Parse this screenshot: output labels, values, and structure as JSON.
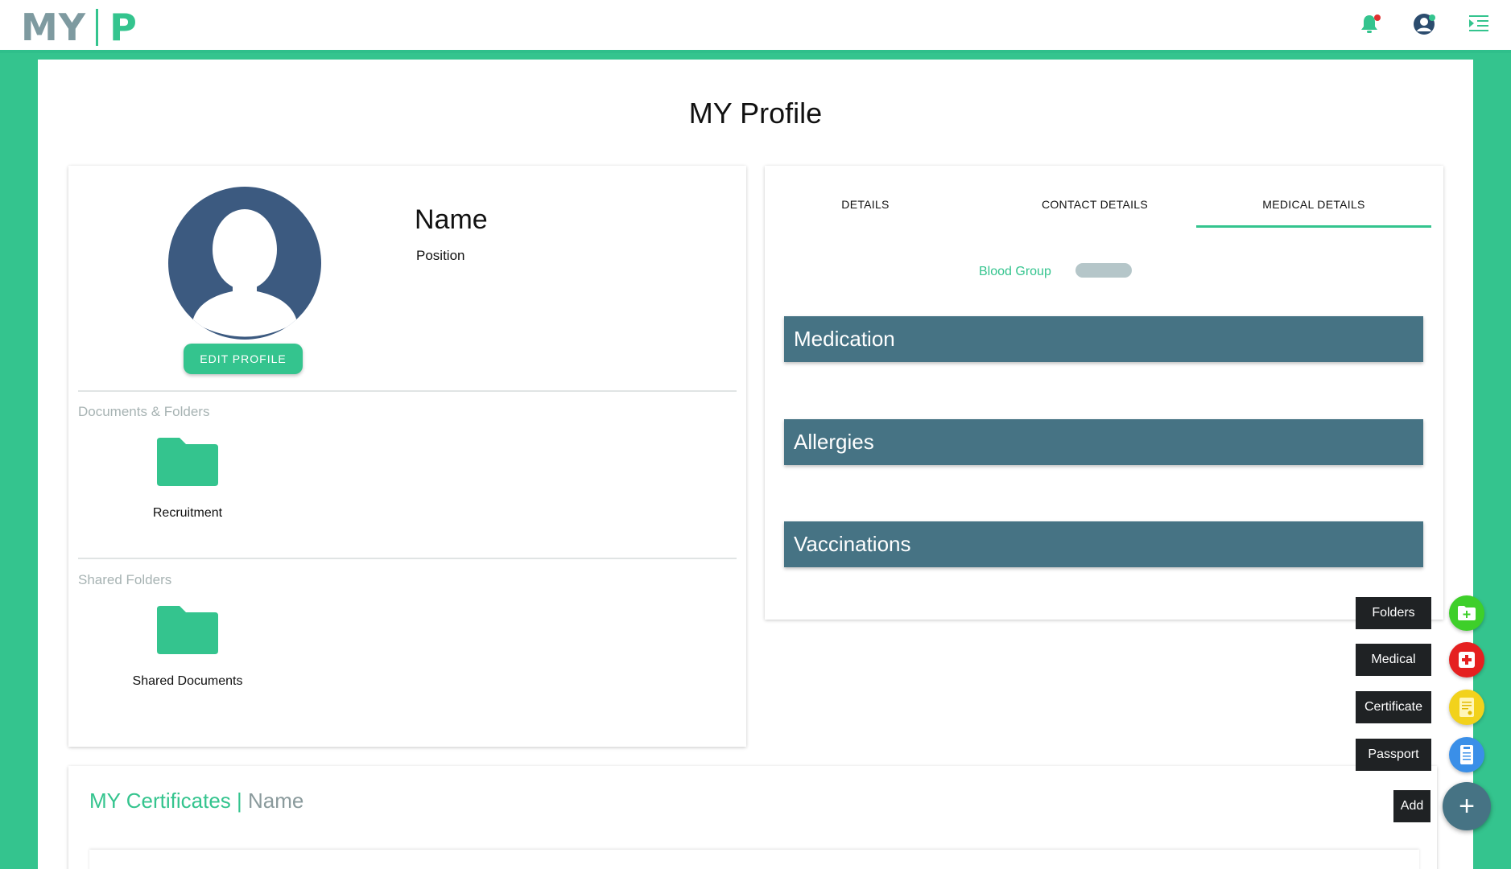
{
  "header": {
    "logo_my": "MY",
    "logo_p": "P",
    "icons": [
      "bell-icon",
      "user-icon",
      "menu-indent-icon"
    ],
    "notification_dot_color": "#e03030",
    "status_dot_color": "#34c48e"
  },
  "page": {
    "title": "MY Profile"
  },
  "profile": {
    "name": "Name",
    "position": "Position",
    "edit_label": "EDIT PROFILE"
  },
  "documents": {
    "section_label": "Documents & Folders",
    "folders": [
      {
        "label": "Recruitment"
      }
    ]
  },
  "shared": {
    "section_label": "Shared Folders",
    "folders": [
      {
        "label": "Shared Documents"
      }
    ]
  },
  "tabs": [
    {
      "label": "DETAILS",
      "active": false
    },
    {
      "label": "CONTACT DETAILS",
      "active": false
    },
    {
      "label": "MEDICAL DETAILS",
      "active": true
    }
  ],
  "medical": {
    "blood_group_label": "Blood Group",
    "sections": [
      "Medication",
      "Allergies",
      "Vaccinations"
    ]
  },
  "certificates": {
    "title": "MY Certificates |",
    "subtitle": "Name"
  },
  "fab": {
    "items": [
      {
        "label": "Folders",
        "icon": "folder-add-icon",
        "color": "#3ecf2a"
      },
      {
        "label": "Medical",
        "icon": "medical-cross-icon",
        "color": "#e52020"
      },
      {
        "label": "Certificate",
        "icon": "certificate-icon",
        "color": "#f2d21c"
      },
      {
        "label": "Passport",
        "icon": "passport-icon",
        "color": "#3a8fe8"
      }
    ],
    "add_label": "Add",
    "add_symbol": "+"
  },
  "colors": {
    "brand_green": "#34c48e",
    "accordion": "#467384",
    "avatar": "#3c5a80"
  }
}
